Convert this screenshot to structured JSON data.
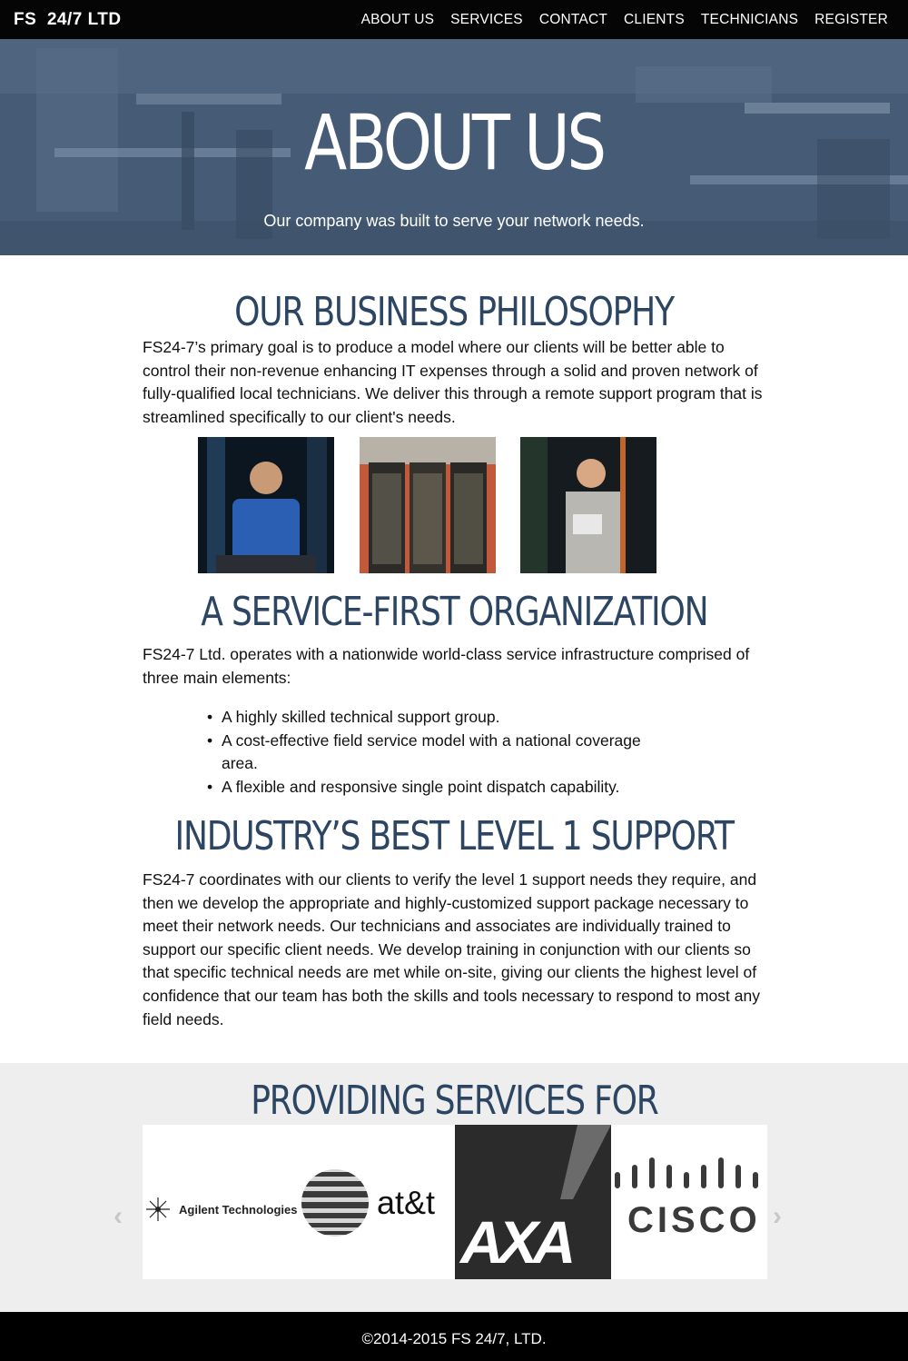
{
  "brand": "FS  24/7 LTD",
  "nav": {
    "items": [
      "ABOUT US",
      "SERVICES",
      "CONTACT",
      "CLIENTS",
      "TECHNICIANS",
      "REGISTER"
    ]
  },
  "hero": {
    "title": "ABOUT US",
    "subtitle": "Our company was built to serve your network needs."
  },
  "sections": {
    "philosophy": {
      "heading": "OUR BUSINESS PHILOSOPHY",
      "body": "FS24-7’s primary goal is to produce a model where our clients will be better able to control their non-revenue enhancing IT expenses through a solid and proven network of fully-qualified local technicians. We deliver this through a remote support program that is streamlined specifically to our client's needs."
    },
    "service_first": {
      "heading": "A SERVICE-FIRST ORGANIZATION",
      "body": "FS24-7 Ltd. operates with a nationwide world-class service infrastructure comprised of three main elements:",
      "bullets": [
        "A highly skilled technical support group.",
        "A cost-effective field service model with a national coverage area.",
        "A flexible and responsive single point dispatch capability."
      ]
    },
    "support": {
      "heading": "INDUSTRY’S BEST LEVEL 1 SUPPORT",
      "body": "FS24-7 coordinates with our clients to verify the level 1 support needs they require, and then we develop the appropriate and highly-customized support package necessary to meet their network needs. Our technicians and associates are individually trained to support our specific client needs. We develop training in conjunction with our clients so that specific technical needs are met while on-site, giving our clients the highest level of confidence that our team has both the skills and tools necessary to respond to most any field needs."
    }
  },
  "clients": {
    "heading": "PROVIDING SERVICES FOR",
    "logos": {
      "agilent": "Agilent Technologies",
      "att": "at&t",
      "axa": "AXA",
      "cisco": "CISCO"
    },
    "prev_arrow": "‹",
    "next_arrow": "›"
  },
  "footer": "©2014-2015 FS 24/7, LTD.",
  "colors": {
    "heading": "#2c4563",
    "nav_bg": "#050505",
    "hero_overlay": "#44596f",
    "clients_bg": "#eeeeee"
  }
}
